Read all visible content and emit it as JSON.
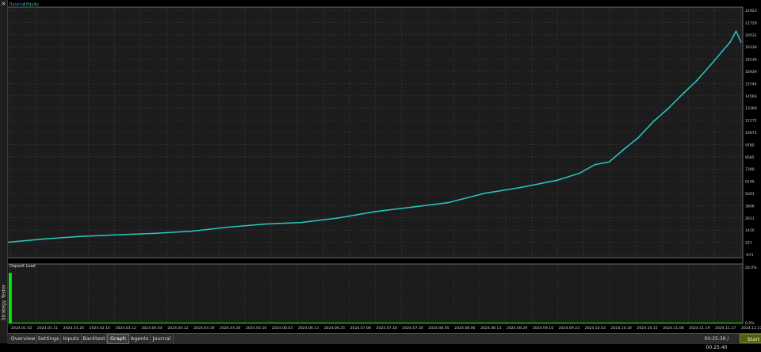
{
  "window": {
    "close_glyph": "×",
    "side_title": "Strategy Tester"
  },
  "tabs": [
    {
      "label": "Overview",
      "active": false
    },
    {
      "label": "Settings",
      "active": false
    },
    {
      "label": "Inputs",
      "active": false
    },
    {
      "label": "Backtest",
      "active": false
    },
    {
      "label": "Graph",
      "active": true
    },
    {
      "label": "Agents",
      "active": false
    },
    {
      "label": "Journal",
      "active": false
    }
  ],
  "status": {
    "timer": "00:25:39 / 00:25:40",
    "start_label": "Start"
  },
  "colors": {
    "balance": "#2f8fe0",
    "equity": "#27d0a0",
    "deposit_load": "#10e010",
    "background": "#1c1c1c",
    "grid": "#3a3a3a"
  },
  "chart_data": [
    {
      "type": "line",
      "legend": {
        "placement": "top-left",
        "entries": [
          {
            "name": "Balance",
            "color": "#2f8fe0"
          },
          {
            "sep": "/"
          },
          {
            "name": "Equity",
            "color": "#27d0a0"
          }
        ]
      },
      "y_ticks": [
        "22923",
        "21726",
        "20531",
        "19339",
        "18136",
        "16939",
        "15744",
        "14566",
        "13369",
        "12172",
        "10975",
        "9780",
        "8585",
        "7390",
        "6195",
        "5001",
        "3806",
        "2611",
        "1416",
        "221",
        "-973"
      ],
      "ylim": [
        -973,
        22923
      ],
      "x_ticks": [
        "2024.01.02",
        "2024.01.11",
        "2024.01.26",
        "2024.02.16",
        "2024.03.12",
        "2024.04.04",
        "2024.04.12",
        "2024.04.19",
        "2024.04.30",
        "2024.05.16",
        "2024.06.03",
        "2024.06.13",
        "2024.06.25",
        "2024.07.08",
        "2024.07.18",
        "2024.07.30",
        "2024.08.05",
        "2024.08.06",
        "2024.08.13",
        "2024.08.29",
        "2024.09.10",
        "2024.09.23",
        "2024.10.03",
        "2024.10.18",
        "2024.10.15",
        "2024.11.08",
        "2024.11.19",
        "2024.11.27",
        "2024.12.17"
      ],
      "series": [
        {
          "name": "Balance",
          "x": [
            0.0,
            0.05,
            0.1,
            0.15,
            0.2,
            0.25,
            0.3,
            0.35,
            0.4,
            0.45,
            0.5,
            0.55,
            0.6,
            0.65,
            0.7,
            0.75,
            0.78,
            0.8,
            0.82,
            0.84,
            0.86,
            0.88,
            0.9,
            0.92,
            0.94,
            0.96,
            0.975,
            0.985,
            0.993,
            1.0
          ],
          "values": [
            221,
            550,
            800,
            950,
            1100,
            1300,
            1700,
            2000,
            2150,
            2600,
            3200,
            3650,
            4100,
            5000,
            5600,
            6300,
            7000,
            7800,
            8100,
            9300,
            10500,
            12000,
            13300,
            14700,
            16100,
            17700,
            19000,
            19800,
            20900,
            19800
          ]
        },
        {
          "name": "Equity",
          "x": [
            0.0,
            0.05,
            0.1,
            0.15,
            0.2,
            0.25,
            0.3,
            0.35,
            0.4,
            0.45,
            0.5,
            0.55,
            0.6,
            0.65,
            0.7,
            0.75,
            0.78,
            0.8,
            0.82,
            0.84,
            0.86,
            0.88,
            0.9,
            0.92,
            0.94,
            0.96,
            0.975,
            0.985,
            0.993,
            1.0
          ],
          "values": [
            221,
            560,
            790,
            960,
            1090,
            1310,
            1690,
            2010,
            2160,
            2590,
            3230,
            3660,
            4080,
            5030,
            5580,
            6330,
            6980,
            7820,
            8080,
            9350,
            10450,
            12050,
            13250,
            14750,
            16050,
            17750,
            18950,
            19850,
            20850,
            19750
          ]
        }
      ]
    },
    {
      "type": "bar",
      "title": "Deposit Load",
      "y_ticks": [
        "20.0%",
        "0.0%"
      ],
      "ylim": [
        0,
        20
      ],
      "series": [
        {
          "name": "Deposit Load",
          "x": [
            0.0,
            0.002
          ],
          "values": [
            18.5,
            18.5
          ]
        }
      ]
    }
  ]
}
